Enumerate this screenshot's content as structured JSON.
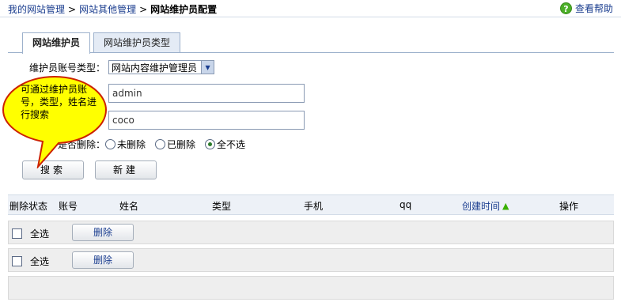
{
  "breadcrumb": {
    "items": [
      "我的网站管理",
      "网站其他管理"
    ],
    "separator": ">",
    "current": "网站维护员配置"
  },
  "help": {
    "icon": "question-icon",
    "label": "查看帮助"
  },
  "tabs": [
    {
      "label": "网站维护员",
      "active": true
    },
    {
      "label": "网站维护员类型",
      "active": false
    }
  ],
  "form": {
    "account_type_label": "维护员账号类型：",
    "account_type_value": "网站内容维护管理员",
    "account_value": "admin",
    "name_value": "coco",
    "deleted_label": "是否删除：",
    "deleted_options": [
      {
        "label": "未删除",
        "checked": false
      },
      {
        "label": "已删除",
        "checked": false
      },
      {
        "label": "全不选",
        "checked": true
      }
    ]
  },
  "buttons": {
    "search": "搜索",
    "new": "新建"
  },
  "tooltip": {
    "text": "可通过维护员账号，类型，姓名进行搜索"
  },
  "table": {
    "columns": [
      "删除状态",
      "账号",
      "姓名",
      "类型",
      "手机",
      "qq",
      "创建时间",
      "操作"
    ],
    "sort_icon": "arrow-up-icon",
    "rows": [
      {
        "select_all_label": "全选",
        "delete_label": "删除"
      },
      {
        "select_all_label": "全选",
        "delete_label": "删除"
      }
    ]
  },
  "colors": {
    "link": "#1a3d8f",
    "help_green": "#4caf28",
    "tooltip_fill": "#ffff00",
    "tooltip_border": "#cc2200"
  }
}
